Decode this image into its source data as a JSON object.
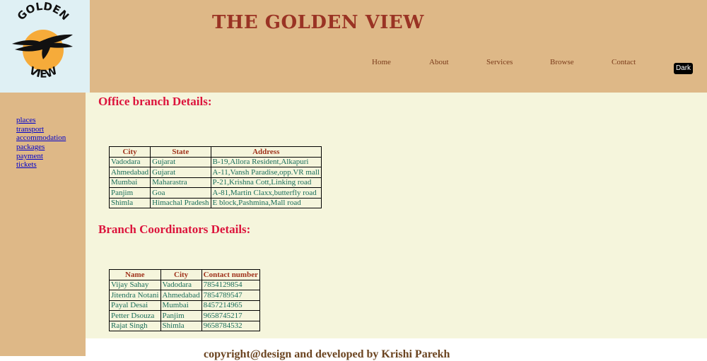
{
  "logo": {
    "top_text": "GOLDEN",
    "bottom_text": "VIEW"
  },
  "header": {
    "title": "THE GOLDEN VIEW"
  },
  "nav": {
    "items": [
      "Home",
      "About",
      "Services",
      "Browse",
      "Contact"
    ]
  },
  "theme_toggle": {
    "label": "Dark"
  },
  "sidebar": {
    "links": [
      "places",
      "transport",
      "accommodation",
      "packages",
      "payment",
      "tickets"
    ]
  },
  "office": {
    "title": "Office branch Details:",
    "headers": [
      "City",
      "State",
      "Address"
    ],
    "rows": [
      [
        "Vadodara",
        "Gujarat",
        "B-19,Allora Resident,Alkapuri"
      ],
      [
        "Ahmedabad",
        "Gujarat",
        "A-11,Vansh Paradise,opp.VR mall"
      ],
      [
        "Mumbai",
        "Maharastra",
        "P-21,Krishna Cott,Linking road"
      ],
      [
        "Panjim",
        "Goa",
        "A-81,Martin Claxx,butterfly road"
      ],
      [
        "Shimla",
        "Himachal Pradesh",
        "E block,Pashmina,Mall road"
      ]
    ]
  },
  "coordinators": {
    "title": "Branch Coordinators Details:",
    "headers": [
      "Name",
      "City",
      "Contact number"
    ],
    "rows": [
      [
        "Vijay Sahay",
        "Vadodara",
        "7854129854"
      ],
      [
        "Jitendra Notani",
        "Ahmedabad",
        "7854789547"
      ],
      [
        "Payal Desai",
        "Mumbai",
        "8457214965"
      ],
      [
        "Petter Dsouza",
        "Panjim",
        "9658745217"
      ],
      [
        "Rajat Singh",
        "Shimla",
        "9658784532"
      ]
    ]
  },
  "footer": {
    "text": "copyright@design and developed by Krishi Parekh"
  },
  "colors": {
    "header_bg": "#deb887",
    "logo_bg": "#dff0f4",
    "main_bg": "#f5f5dc",
    "title": "#9a3324",
    "section_title": "#dc143c",
    "table_header": "#a0331c",
    "table_cell": "#1a6e5a",
    "logo_sun": "#f6ab3a"
  }
}
